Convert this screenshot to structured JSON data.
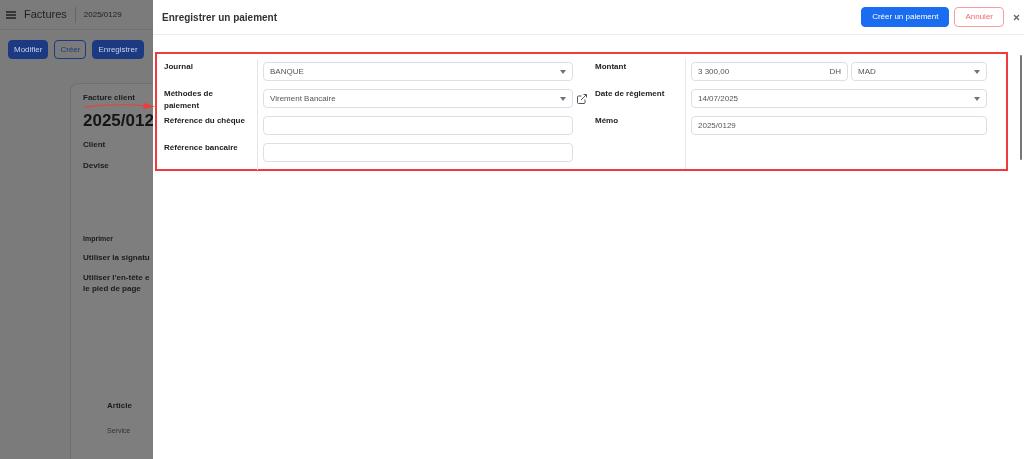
{
  "background": {
    "app_title": "Factures",
    "breadcrumb": "2025/0129",
    "buttons": [
      {
        "label": "Modifier",
        "kind": "primary"
      },
      {
        "label": "Créer",
        "kind": "outline"
      },
      {
        "label": "Enregistrer",
        "kind": "primary"
      }
    ],
    "card": {
      "caption": "Facture client",
      "number": "2025/012",
      "fields": [
        "Client",
        "Devise"
      ],
      "section": "Imprimer",
      "options": [
        "Utiliser la signatu",
        "Utiliser l'en-tête e\nle pied de page"
      ],
      "table_header": "Article",
      "table_row": "Service"
    }
  },
  "dialog": {
    "title": "Enregistrer un paiement",
    "buttons": [
      {
        "label": "Créer un paiement",
        "kind": "primary"
      },
      {
        "label": "Annuler",
        "kind": "danger"
      }
    ],
    "left_fields": [
      {
        "label": "Journal",
        "kind": "select",
        "value": "BANQUE"
      },
      {
        "label": "Méthodes de paiement",
        "kind": "select",
        "value": "Virement Bancaire",
        "external_link": true
      },
      {
        "label": "Référence du chèque",
        "kind": "input"
      },
      {
        "label": "Référence bancaire",
        "kind": "input"
      }
    ],
    "right_fields": [
      {
        "label": "Montant",
        "kind": "amount",
        "value": "3 300,00",
        "unit": "DH",
        "currency": "MAD"
      },
      {
        "label": "Date de règlement",
        "kind": "select",
        "value": "14/07/2025"
      },
      {
        "label": "Mémo",
        "kind": "input",
        "value": "2025/0129"
      }
    ]
  }
}
